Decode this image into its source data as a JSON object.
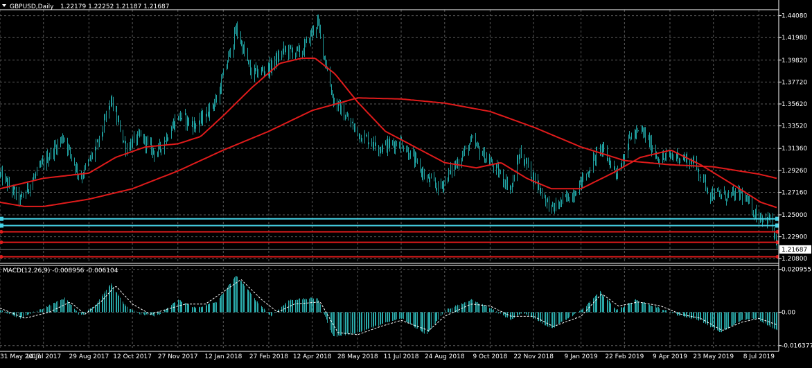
{
  "header": {
    "symbol": "GBPUSD,Daily",
    "ohlc": "1.22179 1.22252 1.21187 1.21687"
  },
  "macd_header": {
    "label": "MACD(12,26,9) -0.008956 -0.006104"
  },
  "colors": {
    "background": "#000000",
    "grid": "#5a5a5a",
    "price": "#1f9e9e",
    "ma": "#e01b1b",
    "level_cyan": "#46d2e6",
    "level_red": "#e01b1b",
    "macd_hist": "#2aa9a9",
    "signal": "#ffffff",
    "text": "#ffffff"
  },
  "chart_data": [
    {
      "type": "line",
      "ylim": [
        1.2055,
        1.4465
      ],
      "y_ticks": [
        "1.44080",
        "1.41980",
        "1.39820",
        "1.37720",
        "1.35620",
        "1.33520",
        "1.31360",
        "1.29260",
        "1.27160",
        "1.25000",
        "1.22900",
        "1.20800"
      ],
      "y_tick_values": [
        1.4408,
        1.4198,
        1.3982,
        1.3772,
        1.3562,
        1.3352,
        1.3136,
        1.2926,
        1.2716,
        1.25,
        1.229,
        1.208
      ],
      "x_ticks": [
        "31 May 2017",
        "14 Jul 2017",
        "29 Aug 2017",
        "12 Oct 2017",
        "27 Nov 2017",
        "12 Jan 2018",
        "27 Feb 2018",
        "12 Apr 2018",
        "28 May 2018",
        "11 Jul 2018",
        "24 Aug 2018",
        "9 Oct 2018",
        "22 Nov 2018",
        "9 Jan 2019",
        "22 Feb 2019",
        "9 Apr 2019",
        "23 May 2019",
        "8 Jul 2019"
      ],
      "current_price": "1.21687",
      "price_keypoints": [
        {
          "x": "2017-05-31",
          "y": 1.288
        },
        {
          "x": "2017-06-20",
          "y": 1.264
        },
        {
          "x": "2017-07-14",
          "y": 1.3
        },
        {
          "x": "2017-08-03",
          "y": 1.325
        },
        {
          "x": "2017-08-20",
          "y": 1.285
        },
        {
          "x": "2017-09-08",
          "y": 1.32
        },
        {
          "x": "2017-09-20",
          "y": 1.36
        },
        {
          "x": "2017-10-05",
          "y": 1.315
        },
        {
          "x": "2017-10-20",
          "y": 1.325
        },
        {
          "x": "2017-11-05",
          "y": 1.308
        },
        {
          "x": "2017-11-27",
          "y": 1.345
        },
        {
          "x": "2017-12-15",
          "y": 1.335
        },
        {
          "x": "2018-01-05",
          "y": 1.36
        },
        {
          "x": "2018-01-25",
          "y": 1.428
        },
        {
          "x": "2018-02-09",
          "y": 1.385
        },
        {
          "x": "2018-02-27",
          "y": 1.39
        },
        {
          "x": "2018-03-15",
          "y": 1.408
        },
        {
          "x": "2018-04-01",
          "y": 1.405
        },
        {
          "x": "2018-04-17",
          "y": 1.435
        },
        {
          "x": "2018-05-03",
          "y": 1.36
        },
        {
          "x": "2018-05-28",
          "y": 1.328
        },
        {
          "x": "2018-06-20",
          "y": 1.315
        },
        {
          "x": "2018-07-11",
          "y": 1.32
        },
        {
          "x": "2018-08-05",
          "y": 1.285
        },
        {
          "x": "2018-08-18",
          "y": 1.275
        },
        {
          "x": "2018-09-20",
          "y": 1.32
        },
        {
          "x": "2018-10-09",
          "y": 1.3
        },
        {
          "x": "2018-10-30",
          "y": 1.275
        },
        {
          "x": "2018-11-08",
          "y": 1.31
        },
        {
          "x": "2018-11-22",
          "y": 1.285
        },
        {
          "x": "2018-12-10",
          "y": 1.255
        },
        {
          "x": "2018-12-31",
          "y": 1.27
        },
        {
          "x": "2019-01-15",
          "y": 1.29
        },
        {
          "x": "2019-01-28",
          "y": 1.315
        },
        {
          "x": "2019-02-14",
          "y": 1.29
        },
        {
          "x": "2019-02-28",
          "y": 1.325
        },
        {
          "x": "2019-03-12",
          "y": 1.33
        },
        {
          "x": "2019-03-29",
          "y": 1.303
        },
        {
          "x": "2019-04-15",
          "y": 1.307
        },
        {
          "x": "2019-05-03",
          "y": 1.3
        },
        {
          "x": "2019-05-20",
          "y": 1.27
        },
        {
          "x": "2019-06-05",
          "y": 1.268
        },
        {
          "x": "2019-06-20",
          "y": 1.27
        },
        {
          "x": "2019-07-05",
          "y": 1.25
        },
        {
          "x": "2019-07-20",
          "y": 1.245
        },
        {
          "x": "2019-07-26",
          "y": 1.21687
        }
      ],
      "ma_fast": [
        {
          "x": "2017-05-31",
          "y": 1.275
        },
        {
          "x": "2017-07-14",
          "y": 1.285
        },
        {
          "x": "2017-08-29",
          "y": 1.29
        },
        {
          "x": "2017-09-25",
          "y": 1.305
        },
        {
          "x": "2017-10-25",
          "y": 1.315
        },
        {
          "x": "2017-11-27",
          "y": 1.318
        },
        {
          "x": "2017-12-20",
          "y": 1.325
        },
        {
          "x": "2018-01-12",
          "y": 1.345
        },
        {
          "x": "2018-02-10",
          "y": 1.372
        },
        {
          "x": "2018-03-10",
          "y": 1.395
        },
        {
          "x": "2018-04-01",
          "y": 1.4
        },
        {
          "x": "2018-04-15",
          "y": 1.4
        },
        {
          "x": "2018-05-05",
          "y": 1.385
        },
        {
          "x": "2018-05-28",
          "y": 1.358
        },
        {
          "x": "2018-06-25",
          "y": 1.33
        },
        {
          "x": "2018-07-25",
          "y": 1.315
        },
        {
          "x": "2018-08-24",
          "y": 1.3
        },
        {
          "x": "2018-09-25",
          "y": 1.295
        },
        {
          "x": "2018-10-20",
          "y": 1.3
        },
        {
          "x": "2018-11-15",
          "y": 1.285
        },
        {
          "x": "2018-12-10",
          "y": 1.275
        },
        {
          "x": "2019-01-09",
          "y": 1.275
        },
        {
          "x": "2019-02-10",
          "y": 1.29
        },
        {
          "x": "2019-03-10",
          "y": 1.305
        },
        {
          "x": "2019-04-10",
          "y": 1.312
        },
        {
          "x": "2019-05-10",
          "y": 1.298
        },
        {
          "x": "2019-06-10",
          "y": 1.28
        },
        {
          "x": "2019-07-10",
          "y": 1.262
        },
        {
          "x": "2019-07-26",
          "y": 1.257
        }
      ],
      "ma_slow": [
        {
          "x": "2017-05-31",
          "y": 1.262
        },
        {
          "x": "2017-06-25",
          "y": 1.258
        },
        {
          "x": "2017-07-14",
          "y": 1.258
        },
        {
          "x": "2017-08-29",
          "y": 1.265
        },
        {
          "x": "2017-10-12",
          "y": 1.275
        },
        {
          "x": "2017-11-27",
          "y": 1.292
        },
        {
          "x": "2018-01-12",
          "y": 1.312
        },
        {
          "x": "2018-02-27",
          "y": 1.33
        },
        {
          "x": "2018-04-12",
          "y": 1.35
        },
        {
          "x": "2018-05-28",
          "y": 1.362
        },
        {
          "x": "2018-07-11",
          "y": 1.361
        },
        {
          "x": "2018-08-24",
          "y": 1.357
        },
        {
          "x": "2018-10-09",
          "y": 1.349
        },
        {
          "x": "2018-11-22",
          "y": 1.334
        },
        {
          "x": "2019-01-09",
          "y": 1.315
        },
        {
          "x": "2019-02-22",
          "y": 1.302
        },
        {
          "x": "2019-04-09",
          "y": 1.298
        },
        {
          "x": "2019-05-23",
          "y": 1.296
        },
        {
          "x": "2019-07-08",
          "y": 1.289
        },
        {
          "x": "2019-07-26",
          "y": 1.285
        }
      ],
      "levels_cyan": [
        1.2462,
        1.2397
      ],
      "levels_red": [
        1.2337,
        1.2237,
        1.2098
      ]
    },
    {
      "type": "bar",
      "title": "MACD(12,26,9) -0.008956 -0.006104",
      "ylim": [
        -0.0185,
        0.0222
      ],
      "y_ticks": [
        "0.020955",
        "0.00",
        "-0.016377"
      ],
      "y_tick_values": [
        0.020955,
        0.0,
        -0.016377
      ],
      "macd": [
        {
          "x": "2017-05-31",
          "y": 0.001
        },
        {
          "x": "2017-06-20",
          "y": -0.003
        },
        {
          "x": "2017-07-14",
          "y": 0.002
        },
        {
          "x": "2017-08-05",
          "y": 0.007
        },
        {
          "x": "2017-08-20",
          "y": -0.002
        },
        {
          "x": "2017-09-05",
          "y": 0.004
        },
        {
          "x": "2017-09-20",
          "y": 0.014
        },
        {
          "x": "2017-10-05",
          "y": 0.003
        },
        {
          "x": "2017-10-20",
          "y": -0.001
        },
        {
          "x": "2017-11-05",
          "y": -0.002
        },
        {
          "x": "2017-11-27",
          "y": 0.006
        },
        {
          "x": "2017-12-15",
          "y": 0.002
        },
        {
          "x": "2018-01-05",
          "y": 0.005
        },
        {
          "x": "2018-01-25",
          "y": 0.018
        },
        {
          "x": "2018-02-15",
          "y": 0.005
        },
        {
          "x": "2018-03-01",
          "y": -0.002
        },
        {
          "x": "2018-03-20",
          "y": 0.006
        },
        {
          "x": "2018-04-17",
          "y": 0.007
        },
        {
          "x": "2018-05-03",
          "y": -0.012
        },
        {
          "x": "2018-05-28",
          "y": -0.01
        },
        {
          "x": "2018-06-20",
          "y": -0.006
        },
        {
          "x": "2018-07-11",
          "y": -0.003
        },
        {
          "x": "2018-08-05",
          "y": -0.011
        },
        {
          "x": "2018-08-24",
          "y": 0.001
        },
        {
          "x": "2018-09-20",
          "y": 0.006
        },
        {
          "x": "2018-10-09",
          "y": 0.002
        },
        {
          "x": "2018-10-30",
          "y": -0.004
        },
        {
          "x": "2018-11-10",
          "y": 0.0
        },
        {
          "x": "2018-11-22",
          "y": -0.003
        },
        {
          "x": "2018-12-10",
          "y": -0.008
        },
        {
          "x": "2019-01-09",
          "y": 0.001
        },
        {
          "x": "2019-01-28",
          "y": 0.01
        },
        {
          "x": "2019-02-14",
          "y": 0.001
        },
        {
          "x": "2019-03-05",
          "y": 0.006
        },
        {
          "x": "2019-03-29",
          "y": 0.002
        },
        {
          "x": "2019-04-20",
          "y": -0.002
        },
        {
          "x": "2019-05-10",
          "y": -0.004
        },
        {
          "x": "2019-05-30",
          "y": -0.01
        },
        {
          "x": "2019-06-20",
          "y": -0.004
        },
        {
          "x": "2019-07-05",
          "y": -0.003
        },
        {
          "x": "2019-07-26",
          "y": -0.008956
        }
      ],
      "signal": [
        {
          "x": "2017-05-31",
          "y": 0.002
        },
        {
          "x": "2017-06-25",
          "y": -0.003
        },
        {
          "x": "2017-07-20",
          "y": 0.0
        },
        {
          "x": "2017-08-10",
          "y": 0.005
        },
        {
          "x": "2017-08-25",
          "y": -0.001
        },
        {
          "x": "2017-09-10",
          "y": 0.005
        },
        {
          "x": "2017-09-25",
          "y": 0.013
        },
        {
          "x": "2017-10-12",
          "y": 0.004
        },
        {
          "x": "2017-10-30",
          "y": -0.001
        },
        {
          "x": "2017-11-20",
          "y": 0.002
        },
        {
          "x": "2017-12-05",
          "y": 0.004
        },
        {
          "x": "2017-12-25",
          "y": 0.004
        },
        {
          "x": "2018-01-12",
          "y": 0.01
        },
        {
          "x": "2018-01-30",
          "y": 0.016
        },
        {
          "x": "2018-02-20",
          "y": 0.006
        },
        {
          "x": "2018-03-08",
          "y": 0.0
        },
        {
          "x": "2018-03-25",
          "y": 0.004
        },
        {
          "x": "2018-04-20",
          "y": 0.005
        },
        {
          "x": "2018-05-08",
          "y": -0.01
        },
        {
          "x": "2018-05-28",
          "y": -0.011
        },
        {
          "x": "2018-06-20",
          "y": -0.007
        },
        {
          "x": "2018-07-11",
          "y": -0.004
        },
        {
          "x": "2018-08-08",
          "y": -0.009
        },
        {
          "x": "2018-08-24",
          "y": -0.002
        },
        {
          "x": "2018-09-20",
          "y": 0.004
        },
        {
          "x": "2018-10-09",
          "y": 0.003
        },
        {
          "x": "2018-10-30",
          "y": -0.002
        },
        {
          "x": "2018-11-22",
          "y": -0.002
        },
        {
          "x": "2018-12-12",
          "y": -0.007
        },
        {
          "x": "2019-01-09",
          "y": -0.002
        },
        {
          "x": "2019-01-30",
          "y": 0.009
        },
        {
          "x": "2019-02-16",
          "y": 0.003
        },
        {
          "x": "2019-03-08",
          "y": 0.005
        },
        {
          "x": "2019-03-31",
          "y": 0.003
        },
        {
          "x": "2019-04-20",
          "y": -0.001
        },
        {
          "x": "2019-05-10",
          "y": -0.003
        },
        {
          "x": "2019-06-01",
          "y": -0.009
        },
        {
          "x": "2019-06-20",
          "y": -0.005
        },
        {
          "x": "2019-07-08",
          "y": -0.003
        },
        {
          "x": "2019-07-26",
          "y": -0.006104
        }
      ]
    }
  ]
}
